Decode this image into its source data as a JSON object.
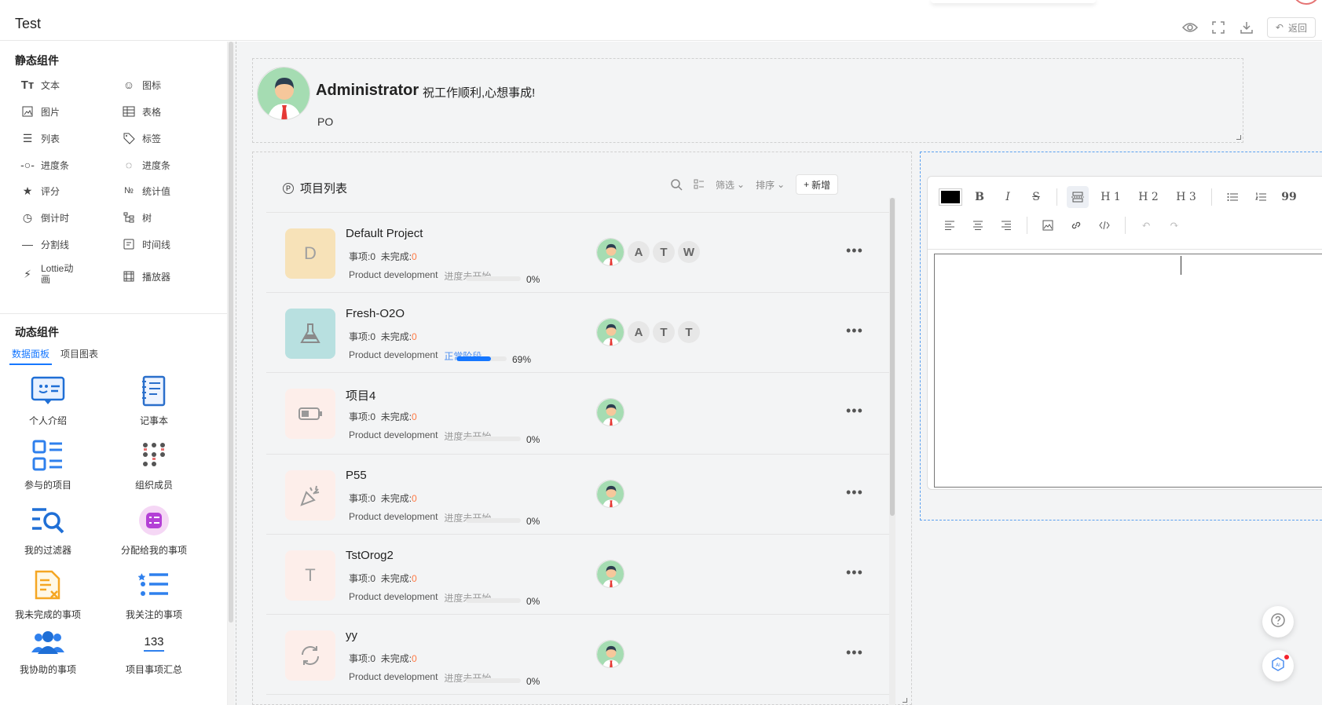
{
  "app": {
    "title": "Test",
    "return_label": "返回"
  },
  "left": {
    "static_title": "静态组件",
    "static_items": [
      {
        "label": "文本",
        "icon": "text-icon"
      },
      {
        "label": "图标",
        "icon": "smile-icon"
      },
      {
        "label": "图片",
        "icon": "image-icon"
      },
      {
        "label": "表格",
        "icon": "table-icon"
      },
      {
        "label": "列表",
        "icon": "list-icon"
      },
      {
        "label": "标签",
        "icon": "tag-icon"
      },
      {
        "label": "进度条",
        "icon": "progress-line-icon"
      },
      {
        "label": "进度条",
        "icon": "progress-circle-icon"
      },
      {
        "label": "评分",
        "icon": "star-icon"
      },
      {
        "label": "统计值",
        "icon": "number-icon"
      },
      {
        "label": "倒计时",
        "icon": "clock-icon"
      },
      {
        "label": "树",
        "icon": "tree-icon"
      },
      {
        "label": "分割线",
        "icon": "divider-icon"
      },
      {
        "label": "时间线",
        "icon": "timeline-icon"
      },
      {
        "label": "Lottie动画",
        "icon": "lottie-icon"
      },
      {
        "label": "播放器",
        "icon": "player-icon"
      }
    ],
    "dynamic_title": "动态组件",
    "tabs": [
      {
        "label": "数据面板",
        "active": true
      },
      {
        "label": "项目图表",
        "active": false
      }
    ],
    "dynamic_items": [
      {
        "label": "个人介绍",
        "icon": "profile-card-icon"
      },
      {
        "label": "记事本",
        "icon": "notebook-icon"
      },
      {
        "label": "参与的项目",
        "icon": "project-list-icon"
      },
      {
        "label": "组织成员",
        "icon": "members-grid-icon"
      },
      {
        "label": "我的过滤器",
        "icon": "filter-search-icon"
      },
      {
        "label": "分配给我的事项",
        "icon": "assigned-tasks-icon"
      },
      {
        "label": "我未完成的事项",
        "icon": "unfinished-doc-icon"
      },
      {
        "label": "我关注的事项",
        "icon": "starred-list-icon"
      },
      {
        "label": "我协助的事项",
        "icon": "team-users-icon"
      },
      {
        "label": "项目事项汇总",
        "icon": "summary-number-icon",
        "value": "133"
      }
    ]
  },
  "welcome": {
    "name": "Administrator",
    "message": "祝工作顺利,心想事成!",
    "role": "PO"
  },
  "projects": {
    "title": "项目列表",
    "filter_label": "筛选",
    "sort_label": "排序",
    "new_label": "新增",
    "stats_items_label": "事项:",
    "stats_unfinished_label": "未完成:",
    "rows": [
      {
        "name": "Default Project",
        "icon_letter": "D",
        "icon_bg": "#f7e2b8",
        "items": "0",
        "unfinished": "0",
        "category": "Product development",
        "phase": "进度未开始",
        "phase_active": false,
        "progress": 0,
        "percent": "0%",
        "member_letters": [
          "A",
          "T",
          "W"
        ]
      },
      {
        "name": "Fresh-O2O",
        "icon_letter": "",
        "icon_bg": "#b8e0e0",
        "items": "0",
        "unfinished": "0",
        "category": "Product development",
        "phase": "正常阶段",
        "phase_active": true,
        "progress": 69,
        "percent": "69%",
        "member_letters": [
          "A",
          "T",
          "T"
        ]
      },
      {
        "name": "项目4",
        "icon_letter": "",
        "icon_bg": "#fdeeea",
        "items": "0",
        "unfinished": "0",
        "category": "Product development",
        "phase": "进度未开始",
        "phase_active": false,
        "progress": 0,
        "percent": "0%",
        "member_letters": []
      },
      {
        "name": "P55",
        "icon_letter": "",
        "icon_bg": "#fdeeea",
        "items": "0",
        "unfinished": "0",
        "category": "Product development",
        "phase": "进度未开始",
        "phase_active": false,
        "progress": 0,
        "percent": "0%",
        "member_letters": []
      },
      {
        "name": "TstOrog2",
        "icon_letter": "T",
        "icon_bg": "#fdeeea",
        "items": "0",
        "unfinished": "0",
        "category": "Product development",
        "phase": "进度未开始",
        "phase_active": false,
        "progress": 0,
        "percent": "0%",
        "member_letters": []
      },
      {
        "name": "yy",
        "icon_letter": "",
        "icon_bg": "#fdeeea",
        "items": "0",
        "unfinished": "0",
        "category": "Product development",
        "phase": "进度未开始",
        "phase_active": false,
        "progress": 0,
        "percent": "0%",
        "member_letters": []
      }
    ]
  },
  "editor": {
    "toolbar": {
      "bold": "B",
      "italic": "I",
      "strike": "S",
      "h1": "H 1",
      "h2": "H 2",
      "h3": "H 3",
      "quote": "99",
      "color": "#000000"
    }
  },
  "colors": {
    "accent": "#1677ff",
    "warning": "#ff7a45"
  }
}
